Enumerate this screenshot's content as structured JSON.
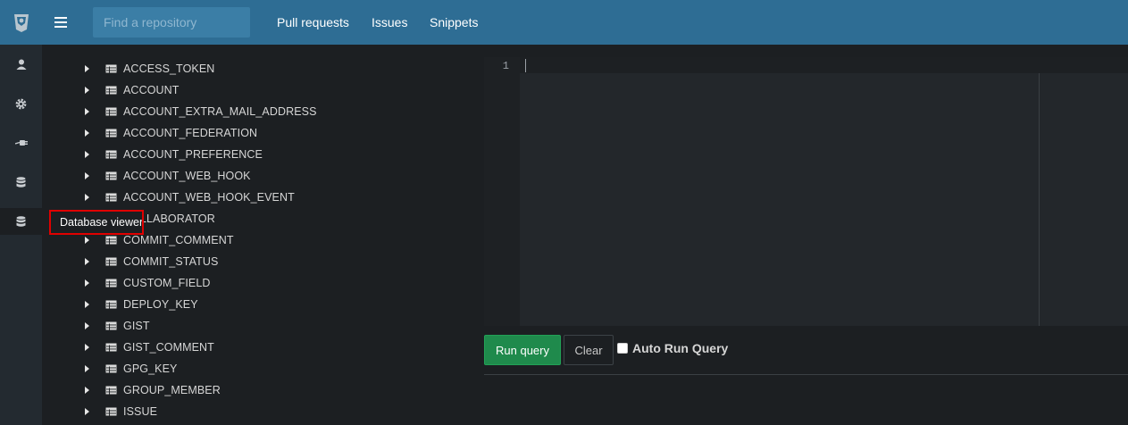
{
  "header": {
    "search_placeholder": "Find a repository",
    "nav": [
      "Pull requests",
      "Issues",
      "Snippets"
    ]
  },
  "sidebar": {
    "icons": [
      "user-icon",
      "gear-icon",
      "plug-icon",
      "database-icon",
      "database-viewer-icon"
    ],
    "tooltip": "Database viewer"
  },
  "tree": {
    "tables": [
      "ACCESS_TOKEN",
      "ACCOUNT",
      "ACCOUNT_EXTRA_MAIL_ADDRESS",
      "ACCOUNT_FEDERATION",
      "ACCOUNT_PREFERENCE",
      "ACCOUNT_WEB_HOOK",
      "ACCOUNT_WEB_HOOK_EVENT",
      "COLLABORATOR",
      "COMMIT_COMMENT",
      "COMMIT_STATUS",
      "CUSTOM_FIELD",
      "DEPLOY_KEY",
      "GIST",
      "GIST_COMMENT",
      "GPG_KEY",
      "GROUP_MEMBER",
      "ISSUE"
    ]
  },
  "editor": {
    "line_number": "1"
  },
  "actions": {
    "run_label": "Run query",
    "clear_label": "Clear",
    "auto_run_label": "Auto Run Query"
  },
  "colors": {
    "header": "#2e6d94",
    "run_button": "#1f8a4c",
    "tooltip_highlight": "#e00000"
  }
}
